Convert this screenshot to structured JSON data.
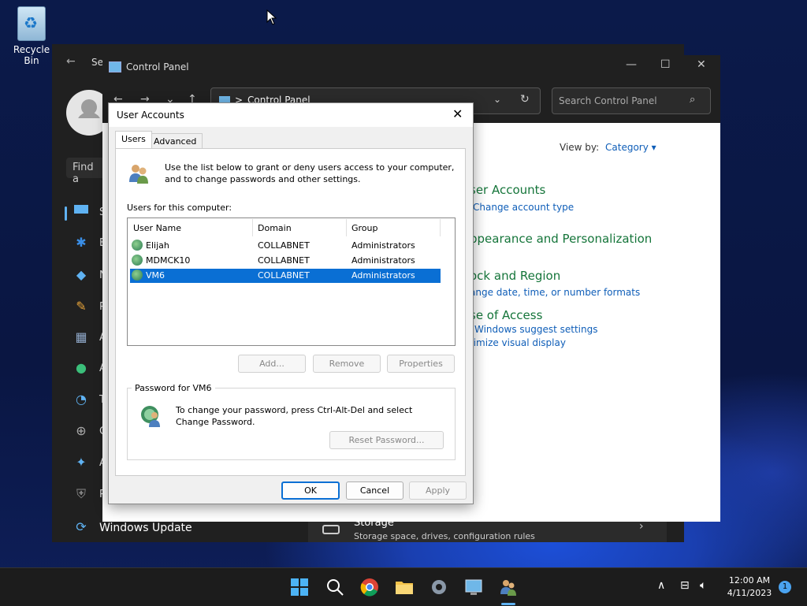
{
  "desktop": {
    "recycle_bin_label": "Recycle Bin"
  },
  "settings_window": {
    "title_partial": "Se",
    "find_partial": "Find a",
    "nav_letters": [
      "S",
      "B",
      "N",
      "P",
      "A",
      "A",
      "T",
      "G",
      "A",
      "P"
    ],
    "windows_update_label": "Windows Update",
    "storage": {
      "title": "Storage",
      "description": "Storage space, drives, configuration rules"
    }
  },
  "control_panel": {
    "title": "Control Panel",
    "breadcrumb_separator": ">",
    "address": "Control Panel",
    "search_placeholder": "Search Control Panel",
    "view_by_label": "View by:",
    "view_by_value": "Category",
    "categories": [
      {
        "title": "ser Accounts",
        "links": [
          "Change account type"
        ]
      },
      {
        "title": "ppearance and Personalization",
        "links": []
      },
      {
        "title": "ock and Region",
        "links": [
          "ange date, time, or number formats"
        ]
      },
      {
        "title": "se of Access",
        "links": [
          "Windows suggest settings",
          "timize visual display"
        ]
      }
    ]
  },
  "dialog": {
    "title": "User Accounts",
    "tabs": [
      "Users",
      "Advanced"
    ],
    "intro": "Use the list below to grant or deny users access to your computer, and to change passwords and other settings.",
    "users_label": "Users for this computer:",
    "columns": [
      "User Name",
      "Domain",
      "Group"
    ],
    "rows": [
      {
        "name": "Elijah",
        "domain": "COLLABNET",
        "group": "Administrators"
      },
      {
        "name": "MDMCK10",
        "domain": "COLLABNET",
        "group": "Administrators"
      },
      {
        "name": "VM6",
        "domain": "COLLABNET",
        "group": "Administrators",
        "selected": true
      }
    ],
    "buttons": {
      "add": "Add...",
      "remove": "Remove",
      "properties": "Properties"
    },
    "password_group": "Password for VM6",
    "password_text": "To change your password, press Ctrl-Alt-Del and select Change Password.",
    "reset_password": "Reset Password...",
    "ok": "OK",
    "cancel": "Cancel",
    "apply": "Apply"
  },
  "taskbar": {
    "time": "12:00 AM",
    "date": "4/11/2023",
    "notification_count": "1",
    "colors": {
      "accent": "#0a6fd4",
      "link": "#0f5eb8",
      "category": "#15753a"
    }
  }
}
